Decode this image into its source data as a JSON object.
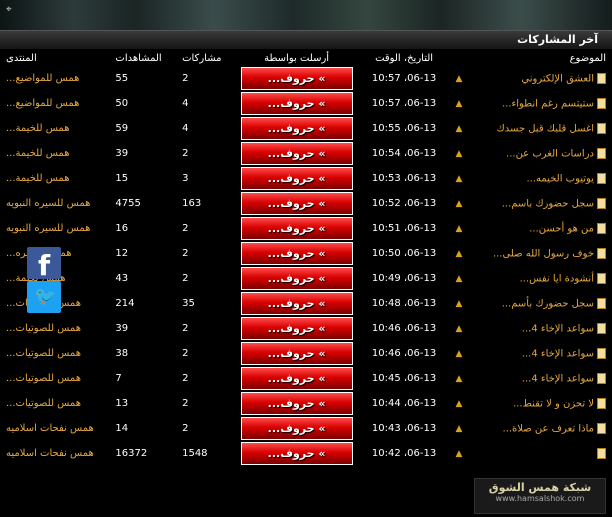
{
  "header": {
    "title": "آخر المشاركات",
    "expand_symbol": "⌖"
  },
  "columns": {
    "topic": "الموضوع",
    "date": "التاريخ، الوقت",
    "by": "أرسلت بواسطة",
    "posts": "مشاركات",
    "views": "المشاهدات",
    "forum": "المنتدى"
  },
  "rows": [
    {
      "topic": "العشق الإلكتروني",
      "date": "06-13، 10:57",
      "by": "» حروف...",
      "posts": "2",
      "views": "55",
      "forum": "همس للمواضيع..."
    },
    {
      "topic": "ستيتسم رغم انطواء...",
      "date": "06-13، 10:57",
      "by": "» حروف...",
      "posts": "4",
      "views": "50",
      "forum": "همس للمواضيع..."
    },
    {
      "topic": "اغسل قلبك قبل جسدك",
      "date": "06-13، 10:55",
      "by": "» حروف...",
      "posts": "4",
      "views": "59",
      "forum": "همس للخيمة..."
    },
    {
      "topic": "دراسات الغرب عن...",
      "date": "06-13، 10:54",
      "by": "» حروف...",
      "posts": "2",
      "views": "39",
      "forum": "همس للخيمة..."
    },
    {
      "topic": "يوتيوب الخيمه...",
      "date": "06-13، 10:53",
      "by": "» حروف...",
      "posts": "3",
      "views": "15",
      "forum": "همس للخيمة..."
    },
    {
      "topic": "سجل حضورك باسم...",
      "date": "06-13، 10:52",
      "by": "» حروف...",
      "posts": "163",
      "views": "4755",
      "forum": "همس للسيره النبويه"
    },
    {
      "topic": "من هو أحسن...",
      "date": "06-13، 10:51",
      "by": "» حروف...",
      "posts": "2",
      "views": "16",
      "forum": "همس للسيره النبويه"
    },
    {
      "topic": "خوف رسول الله صلى...",
      "date": "06-13، 10:50",
      "by": "» حروف...",
      "posts": "2",
      "views": "12",
      "forum": "همس للسيره..."
    },
    {
      "topic": "أنشودة ايا نفس...",
      "date": "06-13، 10:49",
      "by": "» حروف...",
      "posts": "2",
      "views": "43",
      "forum": "همس لكلمة..."
    },
    {
      "topic": "سجل حضورك بأسم...",
      "date": "06-13، 10:48",
      "by": "» حروف...",
      "posts": "35",
      "views": "214",
      "forum": "همس للصوتيات..."
    },
    {
      "topic": "سواعد الإخاء 4...",
      "date": "06-13، 10:46",
      "by": "» حروف...",
      "posts": "2",
      "views": "39",
      "forum": "همس للصوتيات..."
    },
    {
      "topic": "سواعد الإخاء 4...",
      "date": "06-13، 10:46",
      "by": "» حروف...",
      "posts": "2",
      "views": "38",
      "forum": "همس للصوتيات..."
    },
    {
      "topic": "سواعد الإخاء 4...",
      "date": "06-13، 10:45",
      "by": "» حروف...",
      "posts": "2",
      "views": "7",
      "forum": "همس للصوتيات..."
    },
    {
      "topic": "لا تحزن و لا تقنط...",
      "date": "06-13، 10:44",
      "by": "» حروف...",
      "posts": "2",
      "views": "13",
      "forum": "همس للصوتيات..."
    },
    {
      "topic": "ماذا تعرف عن صلاة...",
      "date": "06-13، 10:43",
      "by": "» حروف...",
      "posts": "2",
      "views": "14",
      "forum": "همس نفحات اسلاميه"
    },
    {
      "topic": "",
      "date": "06-13، 10:42",
      "by": "» حروف...",
      "posts": "1548",
      "views": "16372",
      "forum": "همس نفحات اسلاميه"
    }
  ],
  "social": {
    "facebook": "f",
    "twitter": "🐦"
  },
  "logo": {
    "name": "شبكة همس الشوق",
    "url": "www.hamsalshok.com"
  }
}
